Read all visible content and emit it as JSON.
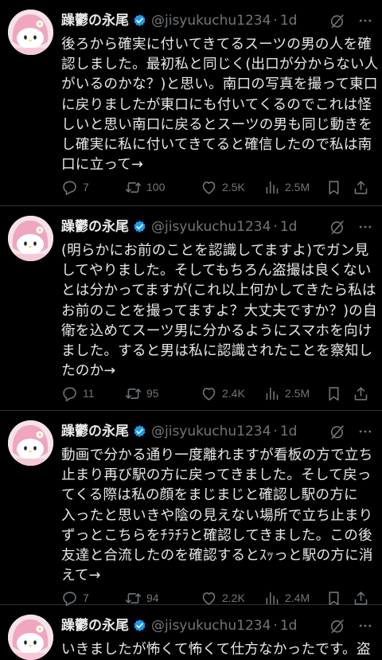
{
  "colors": {
    "background": "#000000",
    "text": "#e7e9ea",
    "muted": "#71767b",
    "verified": "#1d9bf0",
    "divider": "#2f3336"
  },
  "tweets": [
    {
      "author": {
        "name": "躁鬱の永尾",
        "handle": "@jisyukuchu1234",
        "verified_icon": "verified-badge-icon",
        "avatar_icon": "my-melody-avatar"
      },
      "time": "1d",
      "separator": "·",
      "lines": [
        "後ろから確実に付いてきてるスーツの男の人を確",
        "認しました。最初私と同じく(出口が分からない人",
        "がいるのかな？)と思い。南口の写真を撮って東口",
        "に戻りましたが東口にも付いてくるのでこれは怪",
        "しいと思い南口に戻るとスーツの男も同じ動きを",
        "し確実に私に付いてきてると確信したので私は南",
        "口に立って→"
      ],
      "stats": {
        "replies": "7",
        "reposts": "100",
        "likes": "2.5K",
        "views": "2.5M"
      }
    },
    {
      "author": {
        "name": "躁鬱の永尾",
        "handle": "@jisyukuchu1234",
        "verified_icon": "verified-badge-icon",
        "avatar_icon": "my-melody-avatar"
      },
      "time": "1d",
      "separator": "·",
      "lines": [
        "(明らかにお前のことを認識してますよ)でガン見",
        "してやりました。そしてもちろん盗撮は良くない",
        "とは分かってますが(これ以上何かしてきたら私は",
        "お前のことを撮ってますよ？大丈夫ですか？)の自",
        "衛を込めてスーツ男に分かるようにスマホを向け",
        "ました。すると男は私に認識されたことを察知し",
        "たのか→"
      ],
      "stats": {
        "replies": "11",
        "reposts": "95",
        "likes": "2.4K",
        "views": "2.5M"
      }
    },
    {
      "author": {
        "name": "躁鬱の永尾",
        "handle": "@jisyukuchu1234",
        "verified_icon": "verified-badge-icon",
        "avatar_icon": "my-melody-avatar"
      },
      "time": "1d",
      "separator": "·",
      "lines": [
        "動画で分かる通り一度離れますが看板の方で立ち",
        "止まり再び駅の方に戻ってきました。そして戻っ",
        "てくる際は私の顔をまじまじと確認し駅の方に",
        "入ったと思いきや陰の見えない場所で立ち止まり",
        "ずっとこちらをﾁﾗﾁﾗと確認してきました。この後",
        "友達と合流したのを確認するとｽｯっと駅の方に消",
        "えて→"
      ],
      "stats": {
        "replies": "7",
        "reposts": "94",
        "likes": "2.2K",
        "views": "2.4M"
      }
    },
    {
      "author": {
        "name": "躁鬱の永尾",
        "handle": "@jisyukuchu1234",
        "verified_icon": "verified-badge-icon",
        "avatar_icon": "my-melody-avatar"
      },
      "time": "1d",
      "separator": "·",
      "lines": [
        "いきましたが怖くて怖くて仕方なかったです。盗"
      ],
      "stats": null
    }
  ],
  "icons": {
    "reply": "reply-icon",
    "repost": "repost-icon",
    "like": "like-icon",
    "views": "views-icon",
    "bookmark": "bookmark-icon",
    "share": "share-icon",
    "grok": "grok-icon",
    "more": "more-icon"
  }
}
